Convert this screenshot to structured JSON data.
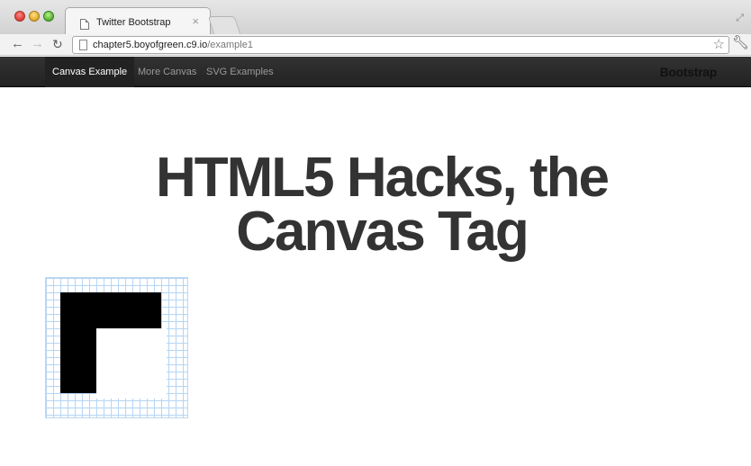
{
  "browser": {
    "tab_title": "Twitter Bootstrap",
    "tab_close": "×",
    "url_host": "chapter5.boyofgreen.c9.io",
    "url_path": "/example1"
  },
  "navbar": {
    "items": [
      {
        "label": "Canvas Example",
        "active": true
      },
      {
        "label": "More Canvas",
        "active": false
      },
      {
        "label": "SVG Examples",
        "active": false
      }
    ],
    "brand": "Bootstrap"
  },
  "hero": {
    "line1": "HTML5 Hacks, the",
    "line2": "Canvas Tag"
  },
  "icons": {
    "back": "back-arrow-icon",
    "forward": "forward-arrow-icon",
    "reload": "reload-icon",
    "star": "star-icon",
    "wrench": "wrench-icon"
  },
  "colors": {
    "navbar_bg": "#222222",
    "hero_text": "#333333",
    "grid_line": "#b5d5f5"
  }
}
